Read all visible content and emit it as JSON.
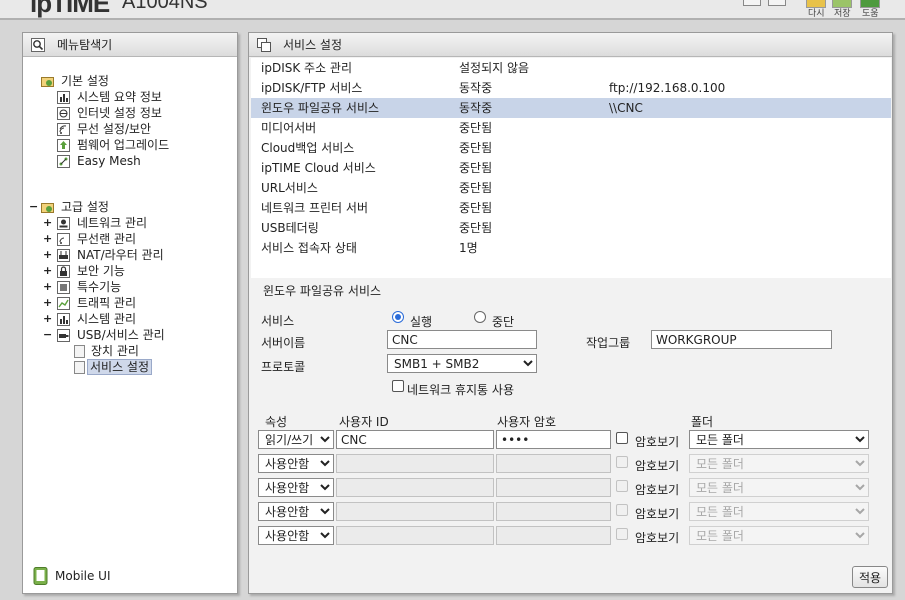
{
  "top": {
    "logo_prefix": "ip",
    "logo_brand": "TIME",
    "model": "A1004NS",
    "buttons": [
      "다시",
      "저장",
      "도움"
    ]
  },
  "left": {
    "header": "메뉴탐색기",
    "basic": {
      "label": "기본 설정",
      "items": [
        "시스템 요약 정보",
        "인터넷 설정 정보",
        "무선 설정/보안",
        "펌웨어 업그레이드",
        "Easy Mesh"
      ]
    },
    "advanced": {
      "label": "고급 설정",
      "items": [
        "네트워크 관리",
        "무선랜 관리",
        "NAT/라우터 관리",
        "보안 기능",
        "특수기능",
        "트래픽 관리",
        "시스템 관리",
        "USB/서비스 관리"
      ],
      "usb_children": [
        "장치 관리",
        "서비스 설정"
      ]
    },
    "mobile": "Mobile UI"
  },
  "right": {
    "header": "서비스 설정",
    "status_rows": [
      {
        "name": "ipDISK 주소 관리",
        "state": "설정되지 않음",
        "info": ""
      },
      {
        "name": "ipDISK/FTP 서비스",
        "state": "동작중",
        "info": "ftp://192.168.0.100"
      },
      {
        "name": "윈도우 파일공유 서비스",
        "state": "동작중",
        "info": "\\\\CNC"
      },
      {
        "name": "미디어서버",
        "state": "중단됨",
        "info": ""
      },
      {
        "name": "Cloud백업 서비스",
        "state": "중단됨",
        "info": ""
      },
      {
        "name": "ipTIME Cloud 서비스",
        "state": "중단됨",
        "info": ""
      },
      {
        "name": "URL서비스",
        "state": "중단됨",
        "info": ""
      },
      {
        "name": "네트워크 프린터 서버",
        "state": "중단됨",
        "info": ""
      },
      {
        "name": "USB테더링",
        "state": "중단됨",
        "info": ""
      },
      {
        "name": "서비스 접속자 상태",
        "state": "1명",
        "info": ""
      }
    ],
    "section_title": "윈도우 파일공유 서비스",
    "form": {
      "service_label": "서비스",
      "run_label": "실행",
      "stop_label": "중단",
      "server_name_label": "서버이름",
      "server_name": "CNC",
      "workgroup_label": "작업그룹",
      "workgroup": "WORKGROUP",
      "protocol_label": "프로토콜",
      "protocol": "SMB1 + SMB2",
      "recycle_label": "네트워크 휴지통 사용"
    },
    "users": {
      "col_attr": "속성",
      "col_id": "사용자 ID",
      "col_pw": "사용자 암호",
      "col_folder": "폴더",
      "show_pw_label": "암호보기",
      "rows": [
        {
          "attr": "읽기/쓰기",
          "id": "CNC",
          "pw": "••••",
          "folder": "모든 폴더"
        },
        {
          "attr": "사용안함",
          "id": "",
          "pw": "",
          "folder": "모든 폴더"
        },
        {
          "attr": "사용안함",
          "id": "",
          "pw": "",
          "folder": "모든 폴더"
        },
        {
          "attr": "사용안함",
          "id": "",
          "pw": "",
          "folder": "모든 폴더"
        },
        {
          "attr": "사용안함",
          "id": "",
          "pw": "",
          "folder": "모든 폴더"
        }
      ]
    },
    "apply_label": "적용"
  }
}
